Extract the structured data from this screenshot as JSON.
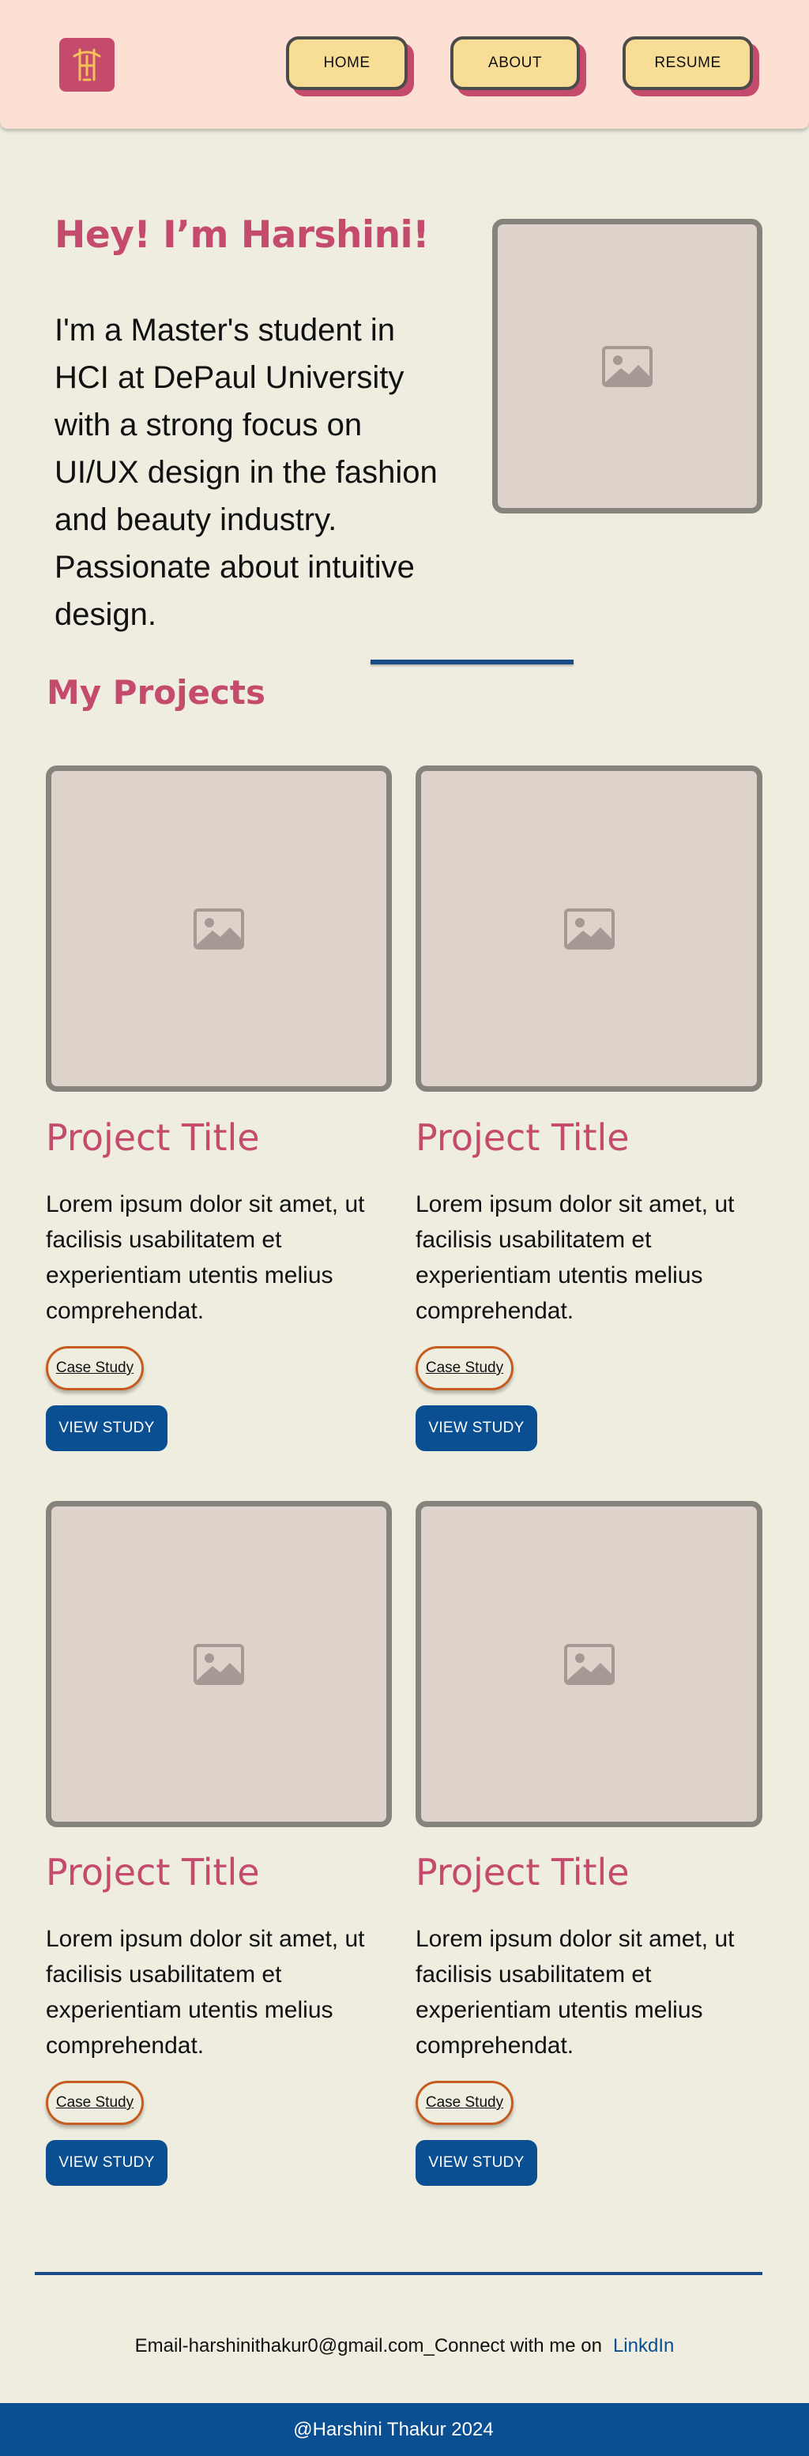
{
  "colors": {
    "accent": "#c54b6c",
    "header_bg": "#fde0d4",
    "page_bg": "#eeeddf",
    "nav_button_bg": "#f7dd96",
    "primary_blue": "#0b4f93",
    "case_border": "#c65b1e"
  },
  "header": {
    "logo_icon": "monogram-logo",
    "nav": [
      {
        "label": "HOME"
      },
      {
        "label": "ABOUT"
      },
      {
        "label": "RESUME"
      }
    ]
  },
  "hero": {
    "title": "Hey! I’m Harshini!",
    "text": "I'm a Master's student in HCI at DePaul University with a strong focus on UI/UX design in the fashion and beauty industry. Passionate about intuitive design.",
    "image_icon": "image-placeholder-icon"
  },
  "projects": {
    "section_title": "My Projects",
    "items": [
      {
        "title": "Project Title",
        "description": "Lorem ipsum dolor sit amet, ut facilisis usabilitatem et experientiam utentis melius comprehendat.",
        "case_label": "Case Study",
        "button_label": "VIEW STUDY"
      },
      {
        "title": "Project Title",
        "description": "Lorem ipsum dolor sit amet, ut facilisis usabilitatem et experientiam utentis melius comprehendat.",
        "case_label": "Case Study",
        "button_label": "VIEW STUDY"
      },
      {
        "title": "Project Title",
        "description": "Lorem ipsum dolor sit amet, ut facilisis usabilitatem et experientiam utentis melius comprehendat.",
        "case_label": "Case Study",
        "button_label": "VIEW STUDY"
      },
      {
        "title": "Project Title",
        "description": "Lorem ipsum dolor sit amet, ut facilisis usabilitatem et experientiam utentis melius comprehendat.",
        "case_label": "Case Study",
        "button_label": "VIEW STUDY"
      }
    ]
  },
  "contact": {
    "text": "Email-harshinithakur0@gmail.com_Connect with me on",
    "link_label": "LinkdIn"
  },
  "footer": {
    "text": "@Harshini Thakur 2024"
  }
}
